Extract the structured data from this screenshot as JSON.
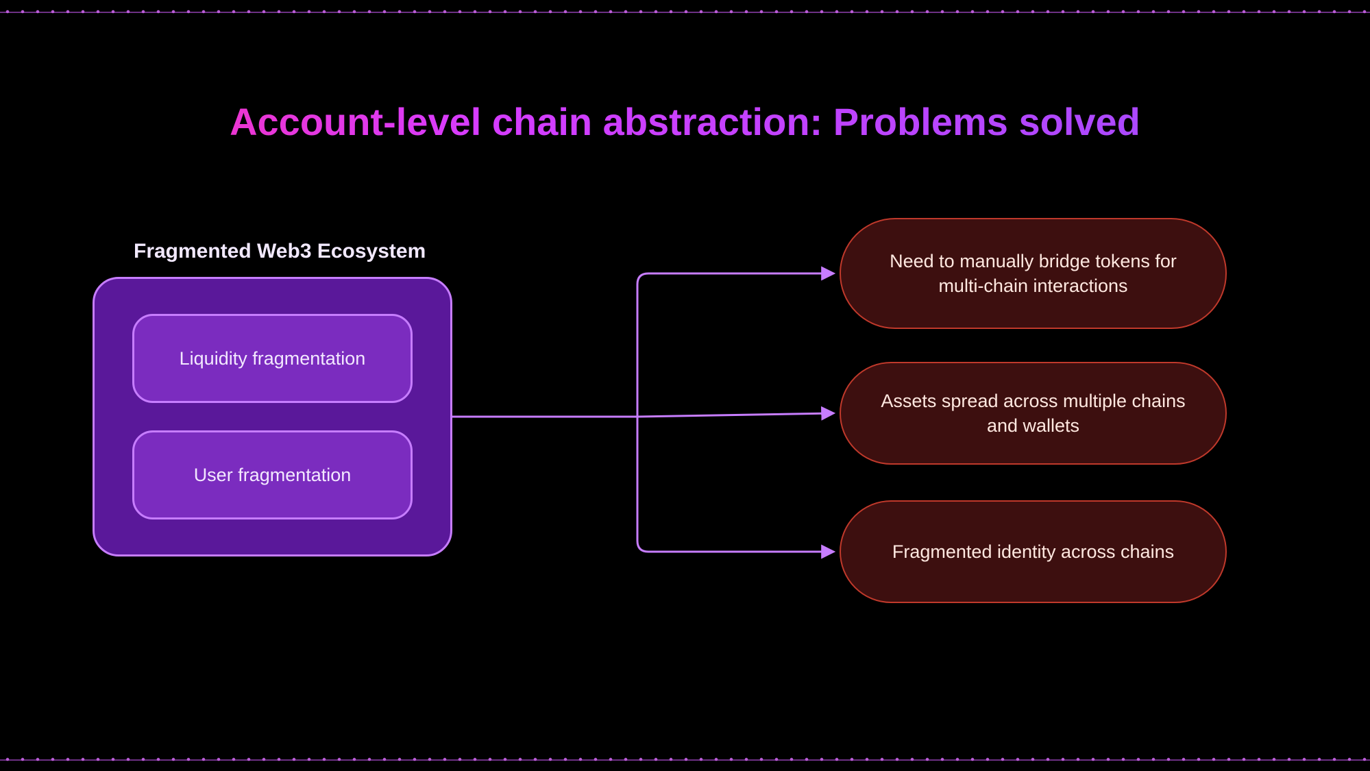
{
  "title": "Account-level chain abstraction: Problems solved",
  "left_group": {
    "header": "Fragmented Web3 Ecosystem",
    "items": [
      "Liquidity fragmentation",
      "User fragmentation"
    ]
  },
  "problems": [
    "Need to manually bridge tokens for multi-chain interactions",
    "Assets spread across multiple chains and wallets",
    "Fragmented identity across chains"
  ],
  "colors": {
    "background": "#000000",
    "title_gradient_start": "#ff2fa8",
    "title_gradient_end": "#9d4dff",
    "panel_fill": "#5a189a",
    "panel_border": "#c77dff",
    "pill_fill": "#7b2cbf",
    "problem_fill": "#3d0f0f",
    "problem_border": "#c0392b",
    "connector": "#c77dff"
  }
}
